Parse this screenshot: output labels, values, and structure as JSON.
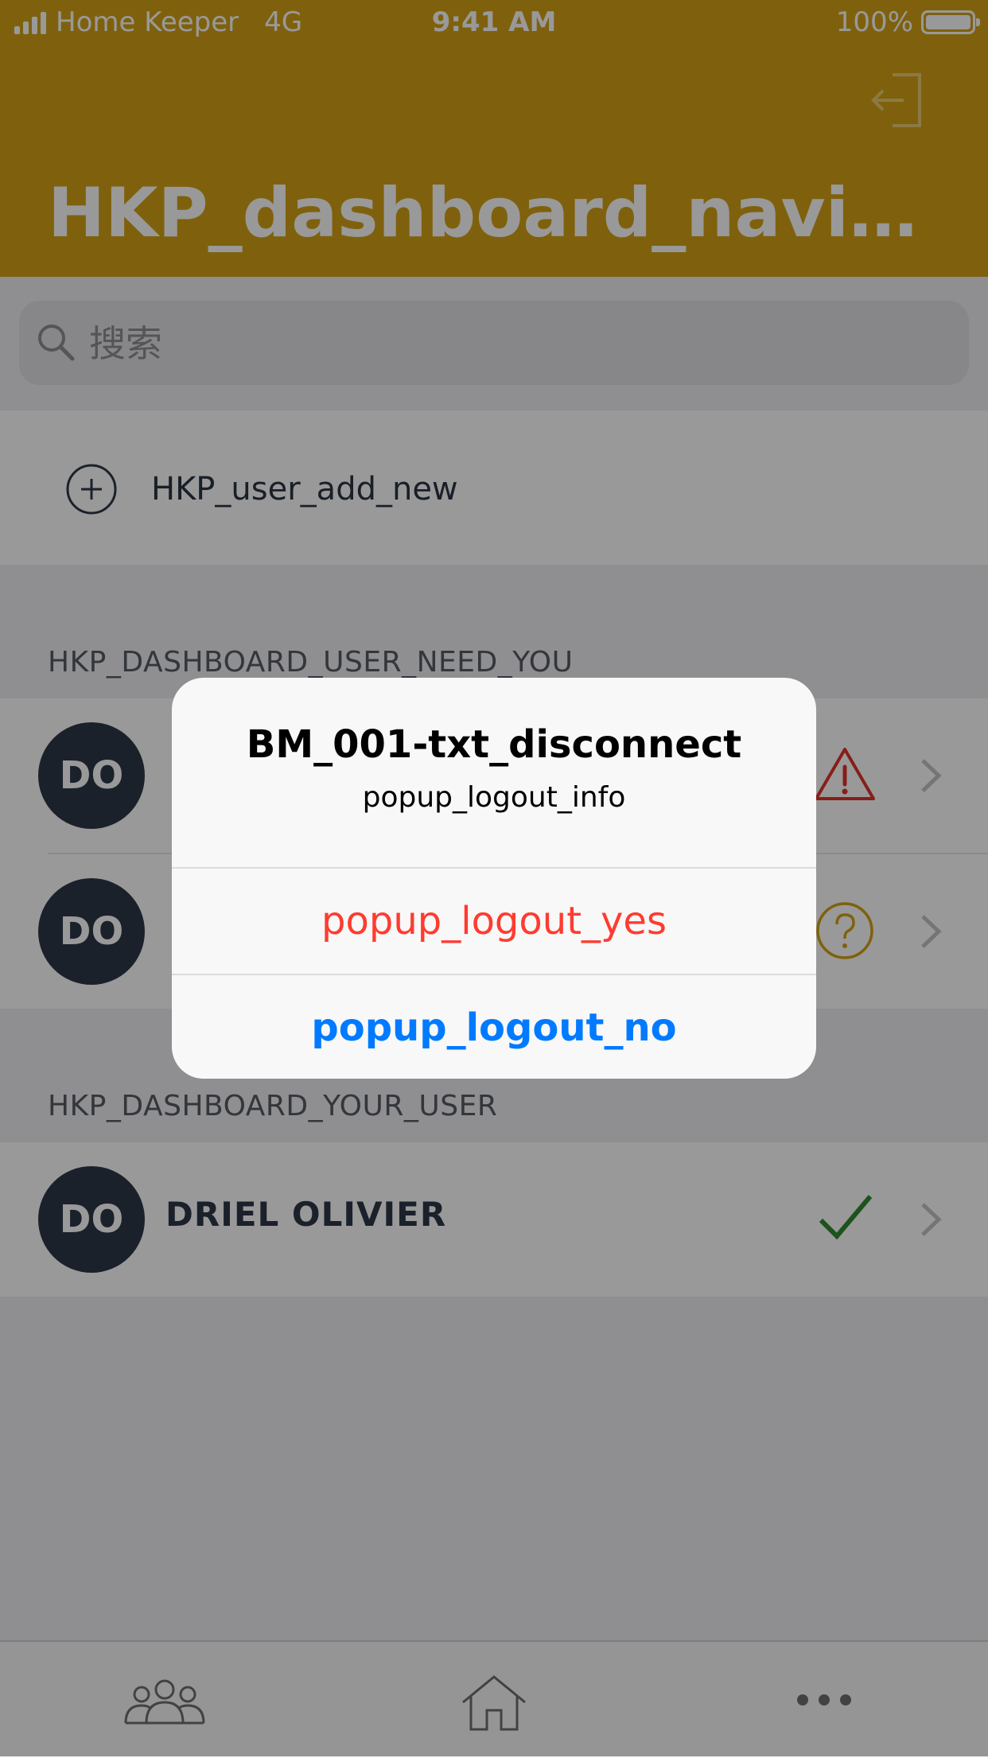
{
  "status_bar": {
    "carrier": "Home Keeper",
    "network": "4G",
    "time": "9:41 AM",
    "battery_text": "100%",
    "battery_level": 1.0
  },
  "header": {
    "title": "HKP_dashboard_navigatio…",
    "background_color": "#d4a216",
    "logout_icon": "logout-icon"
  },
  "search": {
    "placeholder": "搜索",
    "value": ""
  },
  "add_user": {
    "label": "HKP_user_add_new",
    "icon": "plus-circle-icon"
  },
  "sections": {
    "need_you": {
      "label": "HKP_DASHBOARD_USER_NEED_YOU",
      "users": [
        {
          "initials": "DO",
          "status_icon": "warning-icon"
        },
        {
          "initials": "DO",
          "status_icon": "question-circle-icon"
        }
      ]
    },
    "your_user": {
      "label": "HKP_DASHBOARD_YOUR_USER",
      "users": [
        {
          "initials": "DO",
          "name": "DRIEL OLIVIER",
          "status_icon": "checkmark-icon"
        }
      ]
    }
  },
  "tabbar": {
    "tabs": [
      {
        "icon": "users-icon"
      },
      {
        "icon": "home-icon"
      },
      {
        "icon": "more-dots-icon"
      }
    ]
  },
  "alert": {
    "title": "BM_001-txt_disconnect",
    "message": "popup_logout_info",
    "yes_label": "popup_logout_yes",
    "no_label": "popup_logout_no"
  },
  "colors": {
    "accent": "#d4a216",
    "avatar": "#2e3849",
    "destructive": "#ff3b30",
    "link": "#007aff",
    "warning": "#e2332b",
    "question": "#d4a216",
    "success": "#2f8a2f"
  }
}
